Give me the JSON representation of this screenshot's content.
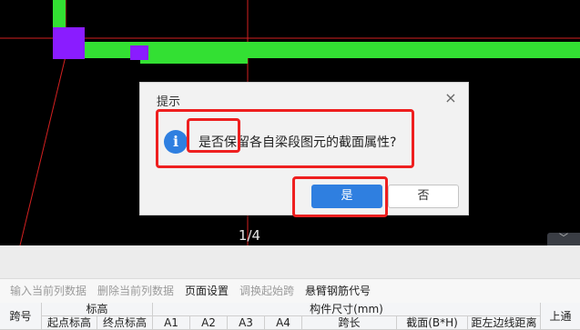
{
  "canvas": {
    "page_indicator": "1/4",
    "collapse_glyph": "﹀"
  },
  "dialog": {
    "title": "提示",
    "close_glyph": "×",
    "icon": "info-icon",
    "icon_glyph": "i",
    "message": "是否保留各自梁段图元的截面属性?",
    "yes_label": "是",
    "no_label": "否"
  },
  "toolbar": {
    "items": [
      {
        "label": "输入当前列数据",
        "enabled": false
      },
      {
        "label": "删除当前列数据",
        "enabled": false
      },
      {
        "label": "页面设置",
        "enabled": true
      },
      {
        "label": "调换起始跨",
        "enabled": false
      },
      {
        "label": "悬臂钢筋代号",
        "enabled": true
      }
    ]
  },
  "grid": {
    "headers_top": {
      "span_no": "跨号",
      "elevation": "标高",
      "dimensions": "构件尺寸(mm)",
      "top_through": "上通"
    },
    "headers_sub": {
      "start_elev": "起点标高",
      "end_elev": "终点标高",
      "a1": "A1",
      "a2": "A2",
      "a3": "A3",
      "a4": "A4",
      "span_len": "跨长",
      "section": "截面(B*H)",
      "left_dist": "距左边线距离"
    }
  },
  "colors": {
    "beam_green": "#33e033",
    "column_purple": "#8a1cff",
    "axis_red": "#d42020",
    "annotation_red": "#ee1f1f",
    "primary_blue": "#2f7fe0"
  }
}
